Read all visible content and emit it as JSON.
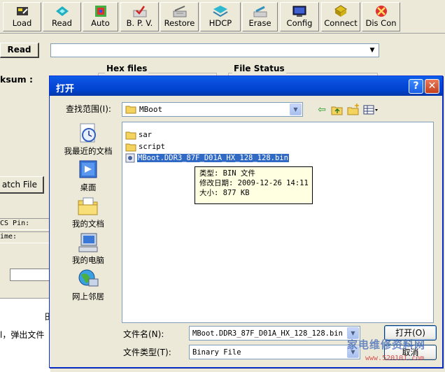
{
  "toolbar": {
    "items": [
      {
        "label": "Load",
        "icon": "load-icon"
      },
      {
        "label": "Read",
        "icon": "read-icon"
      },
      {
        "label": "Auto",
        "icon": "auto-icon"
      },
      {
        "label": "B. P. V.",
        "icon": "bpv-icon"
      },
      {
        "label": "Restore",
        "icon": "restore-icon"
      },
      {
        "label": "HDCP",
        "icon": "hdcp-icon"
      },
      {
        "label": "Erase",
        "icon": "erase-icon"
      },
      {
        "label": "Config",
        "icon": "config-icon"
      },
      {
        "label": "Connect",
        "icon": "connect-icon"
      },
      {
        "label": "Dis Con",
        "icon": "disconnect-icon"
      }
    ]
  },
  "background": {
    "read_button": "Read",
    "checksum_label": "ksum :",
    "hex_files_group": "Hex files",
    "file_status_group": "File Status",
    "batch_file_button": "atch File",
    "cs_pin_label": "CS Pin:",
    "time_label": "ime:",
    "page_text": "l，弹出文件",
    "page_text_2": "田"
  },
  "dialog": {
    "title": "打开",
    "help_label": "?",
    "close_label": "✕",
    "look_in_label": "查找范围(I):",
    "look_in_value": "MBoot",
    "places": [
      {
        "label": "我最近的文档",
        "icon": "recent-documents-icon"
      },
      {
        "label": "桌面",
        "icon": "desktop-icon"
      },
      {
        "label": "我的文档",
        "icon": "my-documents-icon"
      },
      {
        "label": "我的电脑",
        "icon": "my-computer-icon"
      },
      {
        "label": "网上邻居",
        "icon": "network-places-icon"
      }
    ],
    "files": [
      {
        "name": "sar",
        "type": "folder"
      },
      {
        "name": "script",
        "type": "folder"
      },
      {
        "name": "MBoot.DDR3_87F_D01A_HX_128_128.bin",
        "type": "file",
        "selected": true
      }
    ],
    "tooltip": {
      "type_line": "类型: BIN 文件",
      "modified_line": "修改日期: 2009-12-26 14:11",
      "size_line": "大小: 877 KB"
    },
    "file_name_label": "文件名(N):",
    "file_name_value": "MBoot.DDR3_87F_D01A_HX_128_128.bin",
    "file_type_label": "文件类型(T):",
    "file_type_value": "Binary File",
    "open_button": "打开(O)",
    "cancel_button": "取消"
  },
  "watermark": {
    "text": "家电维修资料网",
    "url": "www.520101.com"
  }
}
